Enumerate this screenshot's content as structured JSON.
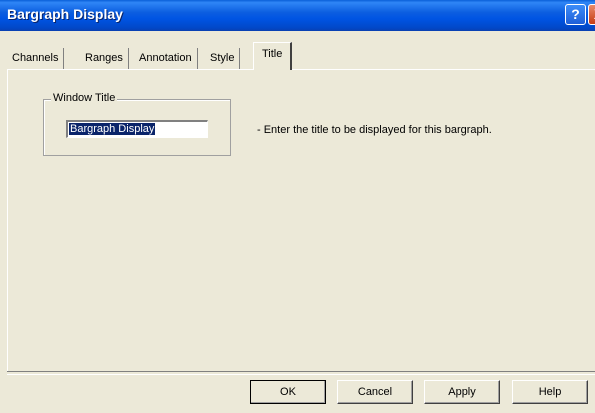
{
  "window": {
    "title": "Bargraph Display",
    "help_glyph": "?",
    "close_glyph": "X"
  },
  "tabs": [
    {
      "label": "Channels"
    },
    {
      "label": "Ranges"
    },
    {
      "label": "Annotation"
    },
    {
      "label": "Style"
    },
    {
      "label": "Title",
      "selected": true
    }
  ],
  "group": {
    "label": "Window Title",
    "input_value": "Bargraph Display"
  },
  "hint": "- Enter the title to be displayed for this bargraph.",
  "buttons": {
    "ok": "OK",
    "cancel": "Cancel",
    "apply": "Apply",
    "help": "Help"
  },
  "colors": {
    "titlebar": "#0054e3",
    "dialog_bg": "#ece9d8",
    "selection": "#0a246a"
  }
}
